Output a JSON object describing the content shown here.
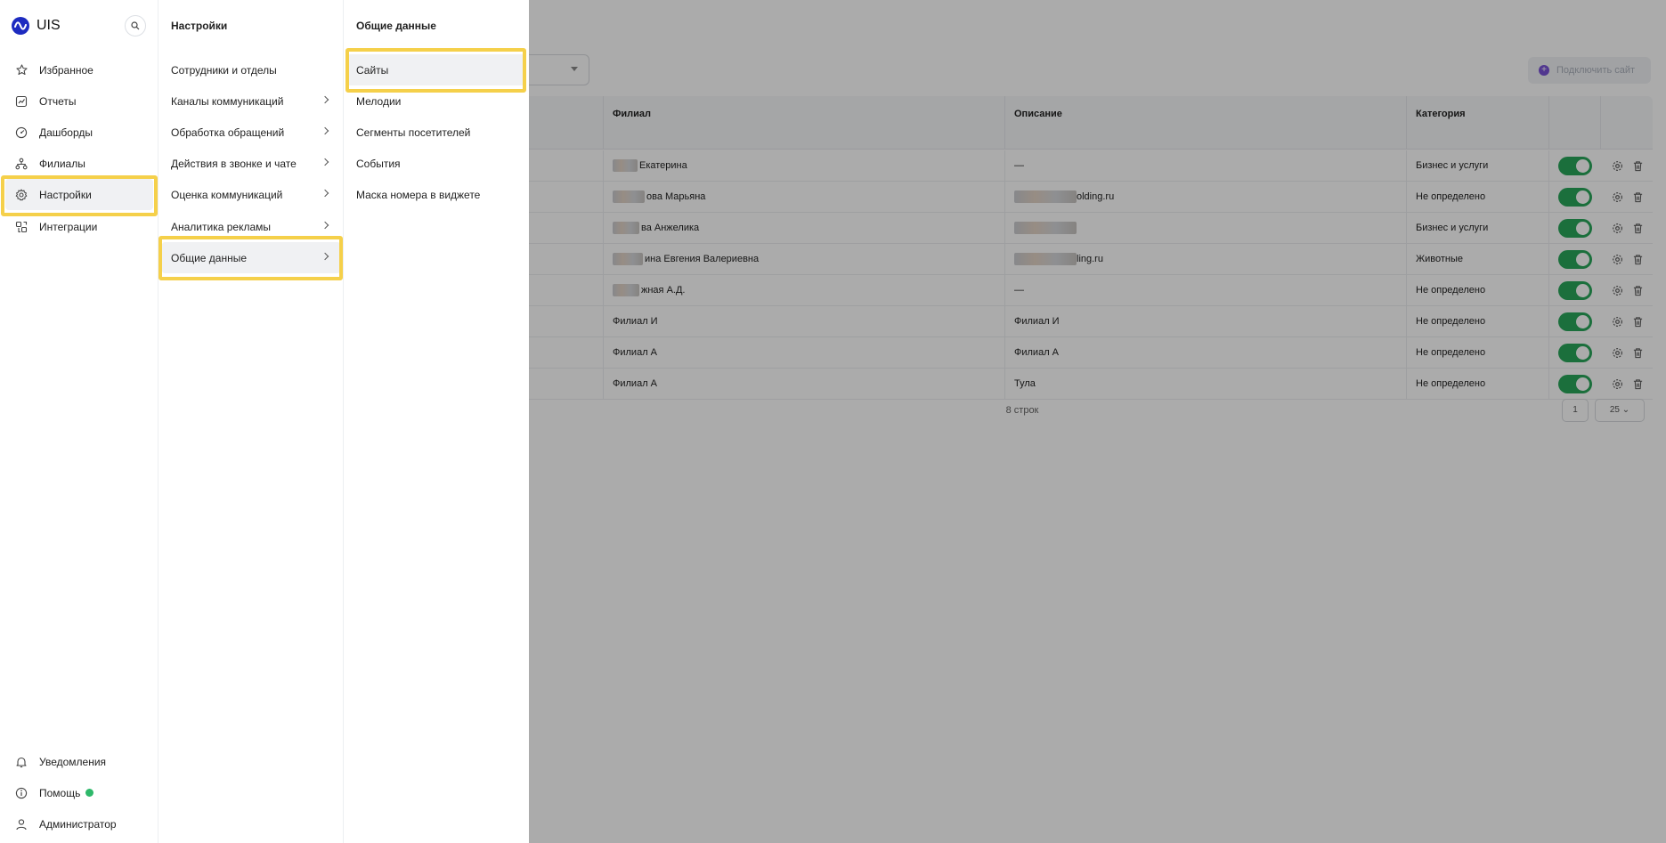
{
  "app": {
    "logo_text": "UIS"
  },
  "sidebar": {
    "items": [
      {
        "label": "Избранное",
        "icon": "star-icon"
      },
      {
        "label": "Отчеты",
        "icon": "chart-icon"
      },
      {
        "label": "Дашборды",
        "icon": "dashboard-icon"
      },
      {
        "label": "Филиалы",
        "icon": "branches-icon"
      },
      {
        "label": "Настройки",
        "icon": "gear-icon",
        "active": true
      },
      {
        "label": "Интеграции",
        "icon": "integrations-icon"
      }
    ],
    "bottom_items": [
      {
        "label": "Уведомления",
        "icon": "bell-icon"
      },
      {
        "label": "Помощь",
        "icon": "info-icon"
      },
      {
        "label": "Администратор",
        "icon": "user-icon"
      }
    ]
  },
  "settings_menu": {
    "title": "Настройки",
    "items": [
      {
        "label": "Сотрудники и отделы"
      },
      {
        "label": "Каналы коммуникаций"
      },
      {
        "label": "Обработка обращений"
      },
      {
        "label": "Действия в звонке и чате"
      },
      {
        "label": "Оценка коммуникаций"
      },
      {
        "label": "Аналитика рекламы"
      },
      {
        "label": "Общие данные"
      }
    ]
  },
  "general_menu": {
    "title": "Общие данные",
    "items": [
      {
        "label": "Сайты"
      },
      {
        "label": "Мелодии"
      },
      {
        "label": "Сегменты посетителей"
      },
      {
        "label": "События"
      },
      {
        "label": "Маска номера в виджете"
      }
    ]
  },
  "page": {
    "connect_button": "Подключить сайт",
    "columns": [
      "Филиал",
      "Описание",
      "Категория"
    ],
    "rows": [
      {
        "branch": "Екатерина",
        "description": "—",
        "category": "Бизнес и услуги"
      },
      {
        "branch": "ова Марьяна",
        "description": "olding.ru",
        "category": "Не определено"
      },
      {
        "branch": "ва Анжелика",
        "description": "",
        "category": "Бизнес и услуги"
      },
      {
        "branch": "ина Евгения Валериевна",
        "description": "ling.ru",
        "category": "Животные"
      },
      {
        "branch": "жная А.Д.",
        "description": "—",
        "category": "Не определено"
      },
      {
        "branch": "Филиал И",
        "description": "Филиал И",
        "category": "Не определено"
      },
      {
        "branch": "Филиал А",
        "description": "Филиал А",
        "category": "Не определено"
      },
      {
        "branch": "Филиал А",
        "description": "Тула",
        "category": "Не определено"
      }
    ],
    "rows_count": "8 строк",
    "page_number": "1",
    "page_size": "25"
  },
  "colors": {
    "highlight": "#f5d04a",
    "toggle_on": "#29a65a",
    "brand": "#1d2bc0",
    "online_dot": "#2eb86a"
  }
}
